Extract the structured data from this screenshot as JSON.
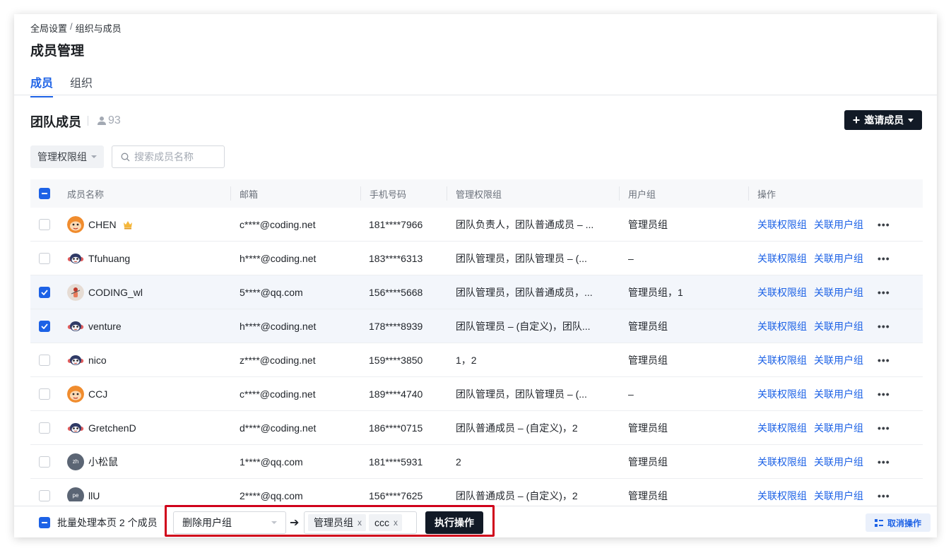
{
  "breadcrumb": {
    "root": "全局设置",
    "separator": "/",
    "current": "组织与成员"
  },
  "page_title": "成员管理",
  "tabs": [
    {
      "label": "成员",
      "active": true
    },
    {
      "label": "组织",
      "active": false
    }
  ],
  "section": {
    "title": "团队成员",
    "member_count": "93",
    "invite_label": "邀请成员"
  },
  "filters": {
    "perm_group_label": "管理权限组",
    "search_placeholder": "搜索成员名称"
  },
  "table": {
    "headers": [
      "成员名称",
      "邮箱",
      "手机号码",
      "管理权限组",
      "用户组",
      "操作"
    ],
    "op_labels": {
      "link_perm": "关联权限组",
      "link_group": "关联用户组",
      "more": "•••"
    },
    "rows": [
      {
        "name": "CHEN",
        "email": "c****@coding.net",
        "phone": "181****7966",
        "perm": "团队负责人，团队普通成员 – ...",
        "group": "管理员组",
        "selected": false,
        "avatar": "monkey-orange",
        "crown": true
      },
      {
        "name": "Tfuhuang",
        "email": "h****@coding.net",
        "phone": "183****6313",
        "perm": "团队管理员，团队管理员 – (...",
        "group": "–",
        "selected": false,
        "avatar": "monkey-navy"
      },
      {
        "name": "CODING_wl",
        "email": "5****@qq.com",
        "phone": "156****5668",
        "perm": "团队管理员，团队普通成员，...",
        "group": "管理员组，1",
        "selected": true,
        "avatar": "photo"
      },
      {
        "name": "venture",
        "email": "h****@coding.net",
        "phone": "178****8939",
        "perm": "团队管理员 – (自定义)，团队...",
        "group": "管理员组",
        "selected": true,
        "avatar": "monkey-navy"
      },
      {
        "name": "nico",
        "email": "z****@coding.net",
        "phone": "159****3850",
        "perm": "1，2",
        "group": "管理员组",
        "selected": false,
        "avatar": "monkey-navy"
      },
      {
        "name": "CCJ",
        "email": "c****@coding.net",
        "phone": "189****4740",
        "perm": "团队管理员，团队管理员 – (...",
        "group": "–",
        "selected": false,
        "avatar": "monkey-orange"
      },
      {
        "name": "GretchenD",
        "email": "d****@coding.net",
        "phone": "186****0715",
        "perm": "团队普通成员 – (自定义)，2",
        "group": "管理员组",
        "selected": false,
        "avatar": "monkey-navy"
      },
      {
        "name": "小松鼠",
        "email": "1****@qq.com",
        "phone": "181****5931",
        "perm": "2",
        "group": "管理员组",
        "selected": false,
        "avatar": "initials",
        "initials": "zh"
      },
      {
        "name": "llU",
        "email": "2****@qq.com",
        "phone": "156****7625",
        "perm": "团队普通成员 – (自定义)，2",
        "group": "管理员组",
        "selected": false,
        "avatar": "initials",
        "initials": "pe"
      }
    ]
  },
  "bulk_bar": {
    "label": "批量处理本页 2 个成员",
    "action": "删除用户组",
    "tags": [
      "管理员组",
      "ccc"
    ],
    "tag_remove": "x",
    "execute_label": "执行操作",
    "cancel_label": "取消操作"
  },
  "colors": {
    "accent": "#1d62e6",
    "dark_button": "#121a26",
    "highlight": "#d0021b",
    "selected_row": "#f3f6fb"
  }
}
